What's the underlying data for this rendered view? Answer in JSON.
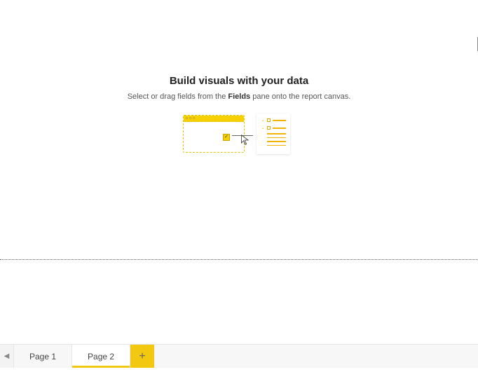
{
  "empty_state": {
    "title": "Build visuals with your data",
    "desc_prefix": "Select or drag fields from the ",
    "desc_bold": "Fields",
    "desc_suffix": " pane onto the report canvas."
  },
  "tabs": {
    "items": [
      {
        "label": "Page 1",
        "active": false
      },
      {
        "label": "Page 2",
        "active": true
      }
    ],
    "add_label": "+"
  }
}
